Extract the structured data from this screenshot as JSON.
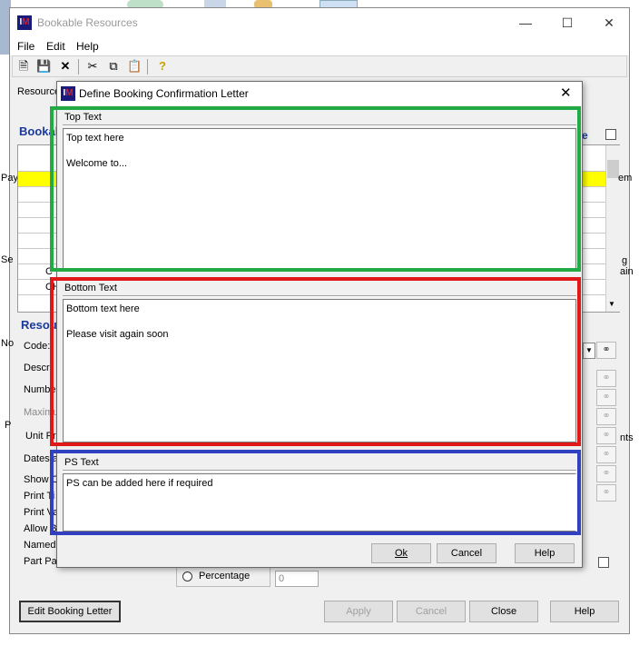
{
  "main_window": {
    "title": "Bookable Resources",
    "menu": [
      "File",
      "Edit",
      "Help"
    ],
    "left_labels": [
      "Pay",
      "Se",
      "No",
      "P"
    ],
    "right_labels": [
      "e",
      "em",
      "g",
      "ain",
      "nts"
    ],
    "resource_label": "Resource",
    "booking_header": "Bookal",
    "grid_texts": [
      "C",
      "CH"
    ],
    "resource_header": "Resou",
    "fields": [
      "Code:",
      "Descri",
      "Number",
      "Maximu",
      "Unit Pri",
      "Dates a",
      "Show C",
      "Print Ti",
      "Print Va",
      "Allow B",
      "Named",
      "Part Pay"
    ],
    "percentage_label": "Percentage",
    "percentage_value": "0",
    "buttons": {
      "edit_booking_letter": "Edit Booking Letter",
      "apply": "Apply",
      "cancel": "Cancel",
      "close": "Close",
      "help": "Help"
    }
  },
  "dialog": {
    "title": "Define Booking Confirmation Letter",
    "top_text": {
      "header": "Top Text",
      "value": "Top text here\n\nWelcome to..."
    },
    "bottom_text": {
      "header": "Bottom Text",
      "value": "Bottom text here\n\nPlease visit again soon"
    },
    "ps_text": {
      "header": "PS Text",
      "value": "PS can be added here if required"
    },
    "buttons": {
      "ok": "Ok",
      "cancel": "Cancel",
      "help": "Help"
    }
  },
  "colors": {
    "top_highlight": "#22aa44",
    "bottom_highlight": "#e01818",
    "ps_highlight": "#3040c0",
    "selected_row": "#ffff00"
  }
}
